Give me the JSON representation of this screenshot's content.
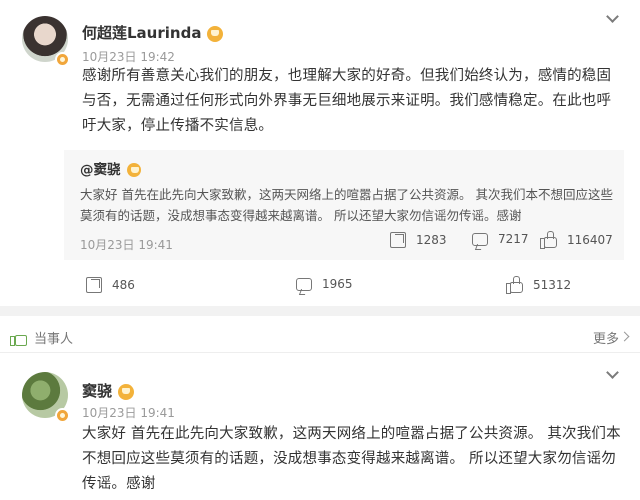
{
  "post1": {
    "username": "何超莲Laurinda",
    "time": "10月23日 19:42",
    "text": "感谢所有善意关心我们的朋友，也理解大家的好奇。但我们始终认为，感情的稳固与否，无需通过任何形式向外界事无巨细地展示来证明。我们感情稳定。在此也呼吁大家，停止传播不实信息。",
    "quoted": {
      "username": "@窦骁",
      "text": "大家好 首先在此先向大家致歉，这两天网络上的喧嚣占据了公共资源。 其次我们本不想回应这些莫须有的话题，没成想事态变得越来越离谱。 所以还望大家勿信谣勿传谣。感谢",
      "time": "10月23日 19:41",
      "reposts": "1283",
      "comments": "7217",
      "likes": "116407"
    },
    "reposts": "486",
    "comments": "1965",
    "likes": "51312"
  },
  "section": {
    "label": "当事人",
    "more": "更多"
  },
  "post2": {
    "username": "窦骁",
    "time": "10月23日 19:41",
    "text": "大家好 首先在此先向大家致歉，这两天网络上的喧嚣占据了公共资源。 其次我们本不想回应这些莫须有的话题，没成想事态变得越来越离谱。 所以还望大家勿信谣勿传谣。感谢"
  }
}
